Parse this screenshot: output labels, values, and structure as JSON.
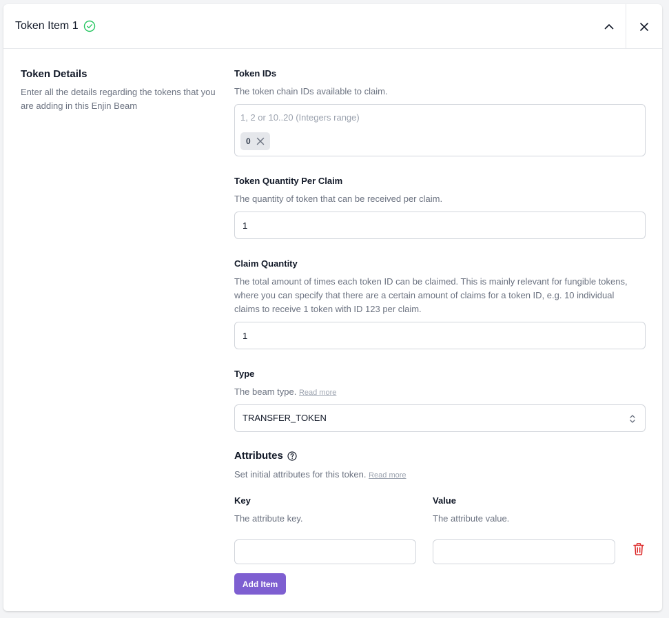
{
  "header": {
    "title": "Token Item 1",
    "status_icon": "check-circle-icon",
    "collapse_icon": "chevron-up-icon",
    "close_icon": "close-icon"
  },
  "section": {
    "title": "Token Details",
    "description": "Enter all the details regarding the tokens that you are adding in this Enjin Beam"
  },
  "token_ids": {
    "label": "Token IDs",
    "help": "The token chain IDs available to claim.",
    "placeholder": "1, 2 or 10..20 (Integers range)",
    "tags": [
      "0"
    ]
  },
  "quantity_per_claim": {
    "label": "Token Quantity Per Claim",
    "help": "The quantity of token that can be received per claim.",
    "value": "1"
  },
  "claim_quantity": {
    "label": "Claim Quantity",
    "help": "The total amount of times each token ID can be claimed. This is mainly relevant for fungible tokens, where you can specify that there are a certain amount of claims for a token ID, e.g. 10 individual claims to receive 1 token with ID 123 per claim.",
    "value": "1"
  },
  "type": {
    "label": "Type",
    "help": "The beam type.",
    "read_more": "Read more",
    "value": "TRANSFER_TOKEN"
  },
  "attributes": {
    "title": "Attributes",
    "help": "Set initial attributes for this token.",
    "read_more": "Read more",
    "key_label": "Key",
    "key_help": "The attribute key.",
    "value_label": "Value",
    "value_help": "The attribute value.",
    "key_value": "",
    "value_value": "",
    "add_button": "Add Item"
  },
  "colors": {
    "accent": "#7e5fd1",
    "success": "#22c55e",
    "danger": "#dc2626"
  }
}
